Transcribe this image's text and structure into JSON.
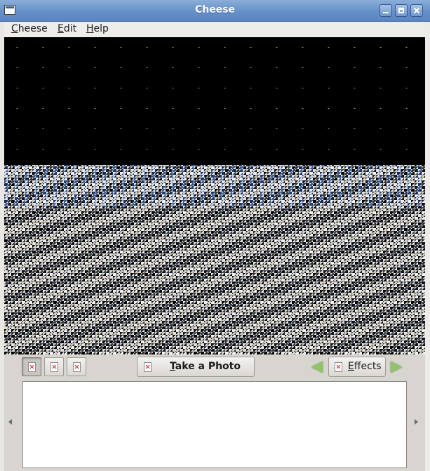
{
  "window": {
    "title": "Cheese"
  },
  "menubar": {
    "items": [
      {
        "label": "Cheese",
        "mnemonic": "C"
      },
      {
        "label": "Edit",
        "mnemonic": "E"
      },
      {
        "label": "Help",
        "mnemonic": "H"
      }
    ]
  },
  "toolbar": {
    "mode_buttons": [
      {
        "name": "photo-mode",
        "active": true
      },
      {
        "name": "video-mode",
        "active": false
      },
      {
        "name": "burst-mode",
        "active": false
      }
    ],
    "take_photo_label": "Take a Photo",
    "effects_label": "Effects"
  },
  "icons": {
    "broken_image": "broken-image-icon",
    "prev": "arrow-left-icon",
    "next": "arrow-right-icon"
  }
}
